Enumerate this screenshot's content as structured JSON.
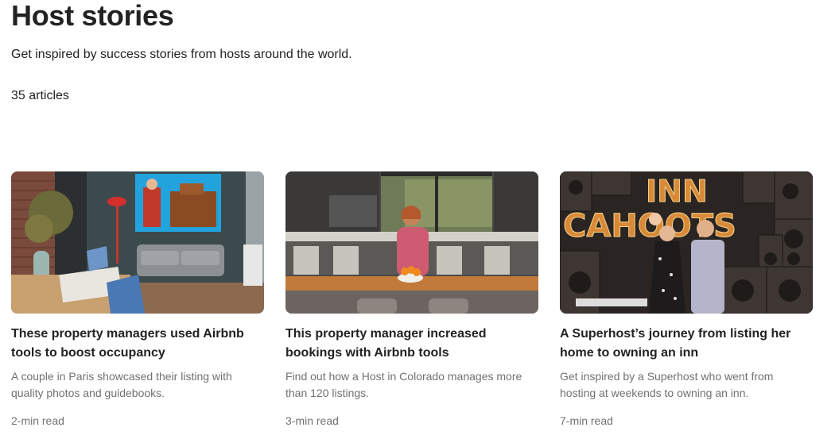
{
  "page": {
    "title": "Host stories",
    "subtitle": "Get inspired by success stories from hosts around the world.",
    "count": "35 articles"
  },
  "articles": [
    {
      "title": "These property managers used Airbnb tools to boost occupancy",
      "description": "A couple in Paris showcased their listing with quality photos and guidebooks.",
      "read_time": "2-min read"
    },
    {
      "title": "This property manager increased bookings with Airbnb tools",
      "description": "Find out how a Host in Colorado manages more than 120 listings.",
      "read_time": "3-min read"
    },
    {
      "title": "A Superhost’s journey from listing her home to owning an inn",
      "description": "Get inspired by a Superhost who went from hosting at weekends to owning an inn.",
      "read_time": "7-min read"
    }
  ],
  "sign_text": "INN CAHOOTS"
}
